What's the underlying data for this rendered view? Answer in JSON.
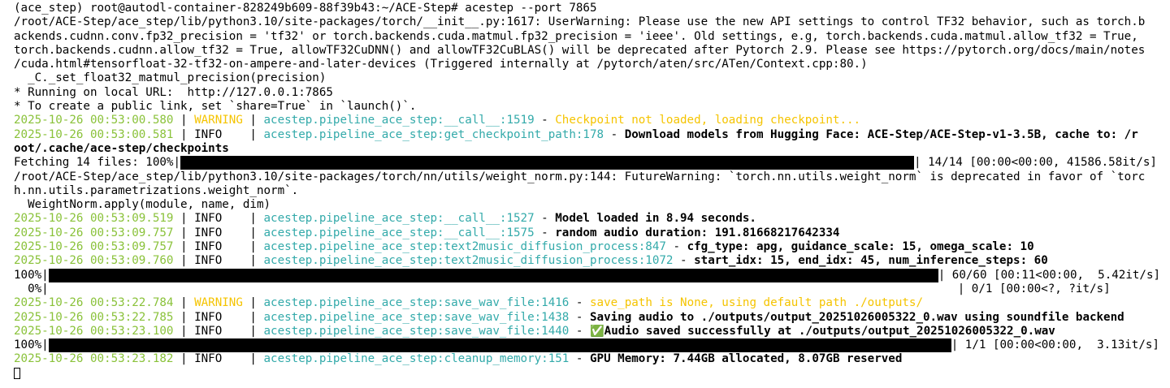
{
  "terminal": {
    "prompt_line": "(ace_step) root@autodl-container-828249b609-88f39b43:~/ACE-Step# acestep --port 7865",
    "tf32_warning": [
      "/root/ACE-Step/ace_step/lib/python3.10/site-packages/torch/__init__.py:1617: UserWarning: Please use the new API settings to control TF32 behavior, such as torch.b",
      "ackends.cudnn.conv.fp32_precision = 'tf32' or torch.backends.cuda.matmul.fp32_precision = 'ieee'. Old settings, e.g, torch.backends.cuda.matmul.allow_tf32 = True,",
      "torch.backends.cudnn.allow_tf32 = True, allowTF32CuDNN() and allowTF32CuBLAS() will be deprecated after Pytorch 2.9. Please see https://pytorch.org/docs/main/notes",
      "/cuda.html#tensorfloat-32-tf32-on-ampere-and-later-devices (Triggered internally at /pytorch/aten/src/ATen/Context.cpp:80.)",
      "  _C._set_float32_matmul_precision(precision)"
    ],
    "running_url": "* Running on local URL:  http://127.0.0.1:7865",
    "public_link": "* To create a public link, set `share=True` in `launch()`.",
    "logs1": [
      {
        "ts": "2025-10-26 00:53:00.580",
        "level": "WARNING",
        "src": "acestep.pipeline_ace_step:__call__:1519",
        "msg": "Checkpoint not loaded, loading checkpoint..."
      },
      {
        "ts": "2025-10-26 00:53:00.581",
        "level": "INFO",
        "src": "acestep.pipeline_ace_step:get_checkpoint_path:178",
        "msg": "Download models from Hugging Face: ACE-Step/ACE-Step-v1-3.5B, cache to: /r"
      }
    ],
    "log1_wrap": "oot/.cache/ace-step/checkpoints",
    "fetch": {
      "prefix": "Fetching 14 files: 100%|",
      "suffix": "| 14/14 [00:00<00:00, 41586.58it/s]",
      "progress": 1.0
    },
    "weightnorm_warning": [
      "/root/ACE-Step/ace_step/lib/python3.10/site-packages/torch/nn/utils/weight_norm.py:144: FutureWarning: `torch.nn.utils.weight_norm` is deprecated in favor of `torc",
      "h.nn.utils.parametrizations.weight_norm`.",
      "  WeightNorm.apply(module, name, dim)"
    ],
    "logs2": [
      {
        "ts": "2025-10-26 00:53:09.519",
        "level": "INFO",
        "src": "acestep.pipeline_ace_step:__call__:1527",
        "msg": "Model loaded in 8.94 seconds."
      },
      {
        "ts": "2025-10-26 00:53:09.757",
        "level": "INFO",
        "src": "acestep.pipeline_ace_step:__call__:1575",
        "msg": "random audio duration: 191.81668217642334"
      },
      {
        "ts": "2025-10-26 00:53:09.757",
        "level": "INFO",
        "src": "acestep.pipeline_ace_step:text2music_diffusion_process:847",
        "msg": "cfg_type: apg, guidance_scale: 15, omega_scale: 10"
      },
      {
        "ts": "2025-10-26 00:53:09.760",
        "level": "INFO",
        "src": "acestep.pipeline_ace_step:text2music_diffusion_process:1072",
        "msg": "start_idx: 15, end_idx: 45, num_inference_steps: 60"
      }
    ],
    "diffusion": {
      "prefix": "100%|",
      "suffix": "| 60/60 [00:11<00:00,  5.42it/s]",
      "progress": 1.0
    },
    "zero_progress": {
      "prefix": "  0%|",
      "suffix": "| 0/1 [00:00<?, ?it/s]"
    },
    "logs3": [
      {
        "ts": "2025-10-26 00:53:22.784",
        "level": "WARNING",
        "src": "acestep.pipeline_ace_step:save_wav_file:1416",
        "msg": "save_path is None, using default path ./outputs/"
      },
      {
        "ts": "2025-10-26 00:53:22.785",
        "level": "INFO",
        "src": "acestep.pipeline_ace_step:save_wav_file:1438",
        "msg": "Saving audio to ./outputs/output_20251026005322_0.wav using soundfile backend"
      },
      {
        "ts": "2025-10-26 00:53:23.100",
        "level": "INFO",
        "src": "acestep.pipeline_ace_step:save_wav_file:1440",
        "msg": "✅Audio saved successfully at ./outputs/output_20251026005322_0.wav"
      }
    ],
    "final_progress": {
      "prefix": "100%|",
      "suffix": "| 1/1 [00:00<00:00,  3.13it/s]",
      "progress": 1.0
    },
    "logs4": [
      {
        "ts": "2025-10-26 00:53:23.182",
        "level": "INFO",
        "src": "acestep.pipeline_ace_step:cleanup_memory:151",
        "msg": "GPU Memory: 7.44GB allocated, 8.07GB reserved"
      }
    ],
    "colors": {
      "timestamp": "#8ac23a",
      "warning": "#f5c400",
      "source": "#33aaaa",
      "bar": "#000000"
    }
  }
}
